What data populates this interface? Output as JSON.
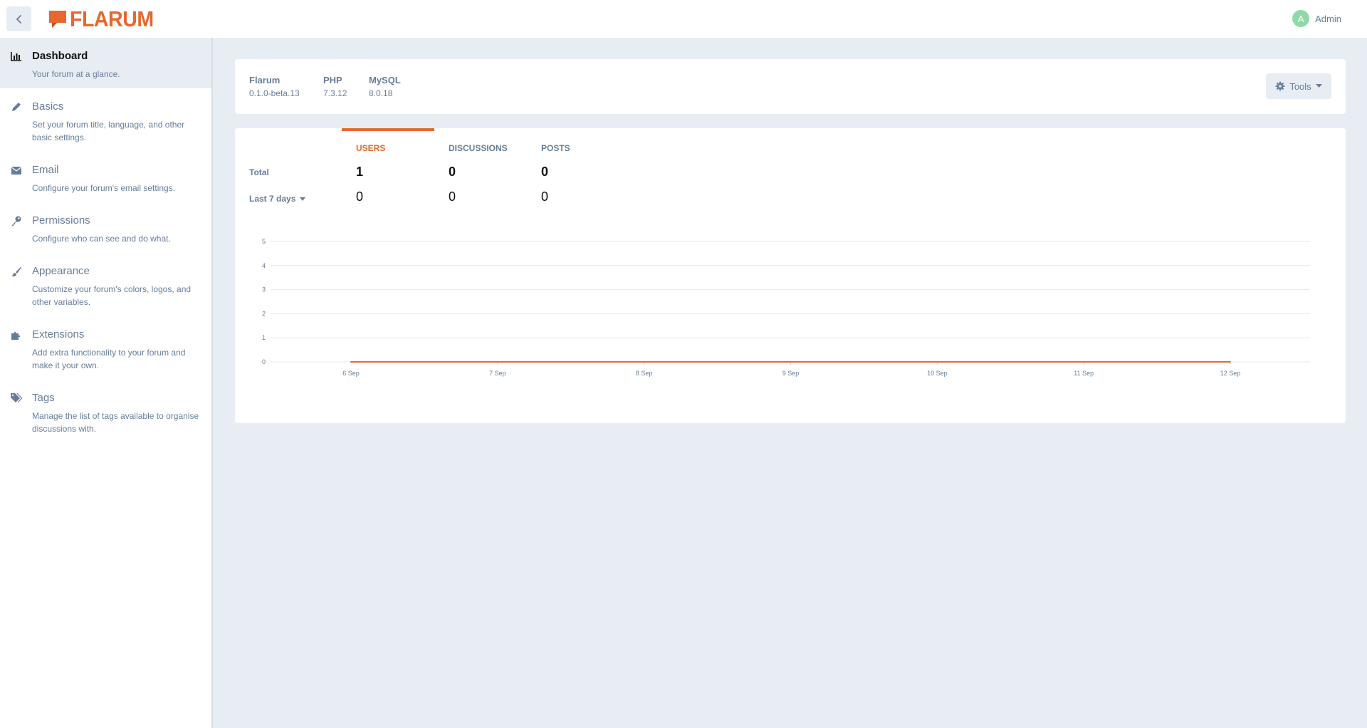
{
  "header": {
    "back_icon": "chevron-left-icon",
    "logo_text": "FLARUM",
    "user": {
      "avatar_letter": "A",
      "name": "Admin",
      "avatar_color": "#90d9a5"
    }
  },
  "sidebar": {
    "items": [
      {
        "title": "Dashboard",
        "desc": "Your forum at a glance.",
        "icon": "chart-icon",
        "active": true
      },
      {
        "title": "Basics",
        "desc": "Set your forum title, language, and other basic settings.",
        "icon": "pencil-icon"
      },
      {
        "title": "Email",
        "desc": "Configure your forum's email settings.",
        "icon": "envelope-icon"
      },
      {
        "title": "Permissions",
        "desc": "Configure who can see and do what.",
        "icon": "key-icon"
      },
      {
        "title": "Appearance",
        "desc": "Customize your forum's colors, logos, and other variables.",
        "icon": "paintbrush-icon"
      },
      {
        "title": "Extensions",
        "desc": "Add extra functionality to your forum and make it your own.",
        "icon": "puzzle-icon"
      },
      {
        "title": "Tags",
        "desc": "Manage the list of tags available to organise discussions with.",
        "icon": "tags-icon"
      }
    ]
  },
  "versions": [
    {
      "name": "Flarum",
      "value": "0.1.0-beta.13"
    },
    {
      "name": "PHP",
      "value": "7.3.12"
    },
    {
      "name": "MySQL",
      "value": "8.0.18"
    }
  ],
  "tools": {
    "label": "Tools",
    "icon": "gear-icon"
  },
  "stats": {
    "headers": [
      "USERS",
      "DISCUSSIONS",
      "POSTS"
    ],
    "active_header": "USERS",
    "total_label": "Total",
    "period_label": "Last 7 days",
    "totals": [
      "1",
      "0",
      "0"
    ],
    "period_values": [
      "0",
      "0",
      "0"
    ]
  },
  "colors": {
    "accent": "#e7672e",
    "muted_text": "#667d99",
    "background": "#e7edf3"
  },
  "chart_data": {
    "type": "line",
    "x": [
      "6 Sep",
      "7 Sep",
      "8 Sep",
      "9 Sep",
      "10 Sep",
      "11 Sep",
      "12 Sep"
    ],
    "series": [
      {
        "values": [
          0,
          0,
          0,
          0,
          0,
          0,
          0
        ],
        "color": "#e7672e"
      }
    ],
    "y_ticks": [
      0,
      1,
      2,
      3,
      4,
      5
    ],
    "ylim": [
      0,
      5
    ],
    "grid": true,
    "title": "",
    "xlabel": "",
    "ylabel": ""
  }
}
